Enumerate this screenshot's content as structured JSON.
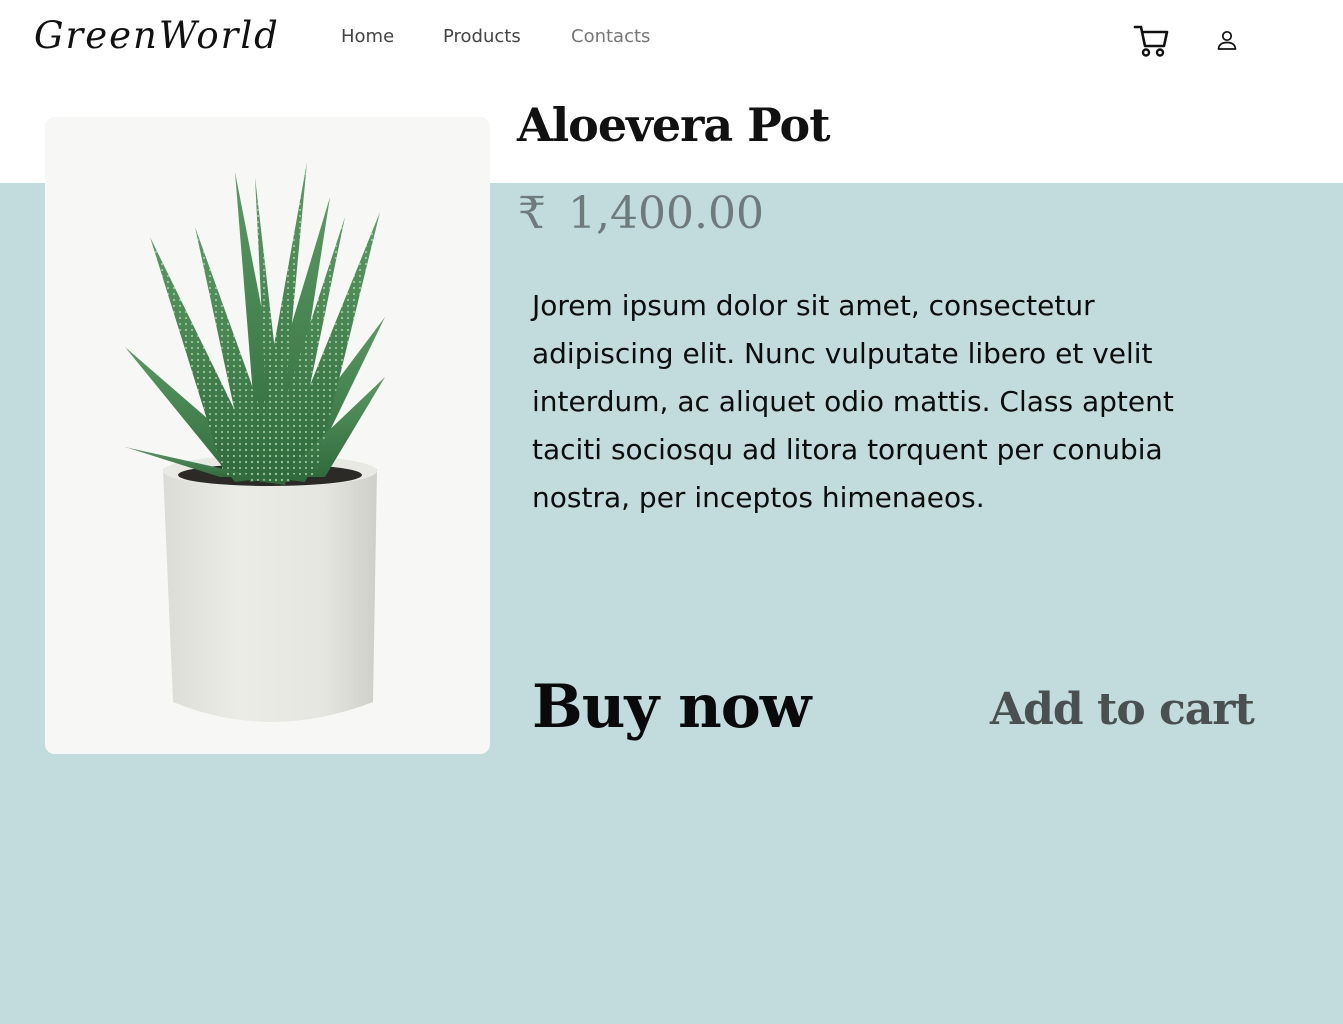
{
  "brand": {
    "logo_text": "GreenWorld"
  },
  "nav": {
    "home": "Home",
    "products": "Products",
    "contacts": "Contacts"
  },
  "header_icons": {
    "cart": "cart-icon",
    "user": "user-icon"
  },
  "product": {
    "image": "aloe-vera-pot-photo",
    "title": "Aloevera Pot",
    "currency_symbol": "₹",
    "price": "1,400.00",
    "description": " Jorem ipsum dolor sit amet, consectetur adipiscing elit. Nunc vulputate libero et velit interdum, ac aliquet odio mattis. Class aptent taciti sociosqu ad litora torquent per conubia nostra, per inceptos himenaeos."
  },
  "actions": {
    "buy_now": "Buy now",
    "add_to_cart": "Add to cart"
  },
  "colors": {
    "band_background": "#c2dcdd",
    "price_color": "#6e7a7b",
    "add_to_cart_color": "#4a5050"
  }
}
